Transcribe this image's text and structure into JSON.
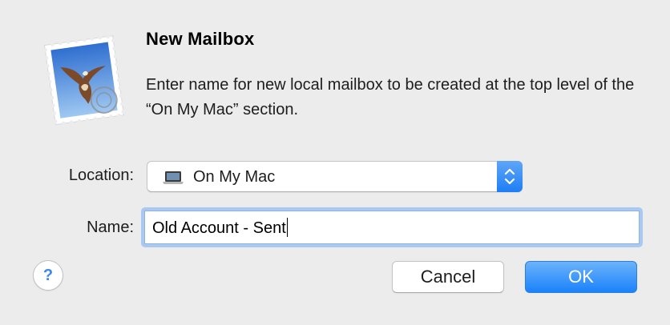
{
  "dialog": {
    "title": "New Mailbox",
    "message": "Enter name for new local mailbox to be created at the top level of the “On My Mac” section.",
    "app_icon": "mail-stamp-icon"
  },
  "location": {
    "label": "Location:",
    "value": "On My Mac",
    "value_icon": "laptop-icon"
  },
  "name": {
    "label": "Name:",
    "value": "Old Account - Sent"
  },
  "buttons": {
    "help": "?",
    "cancel": "Cancel",
    "ok": "OK"
  },
  "colors": {
    "accent": "#1a82fb",
    "focus_ring": "#a9c9f3",
    "background": "#ececec"
  }
}
